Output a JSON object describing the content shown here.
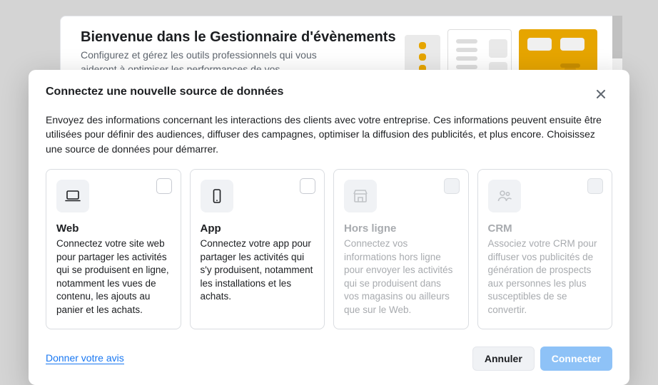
{
  "background": {
    "welcome_title": "Bienvenue dans le Gestionnaire d'évènements",
    "welcome_body": "Configurez et gérez les outils professionnels qui vous aideront à optimiser les performances de vos publicités."
  },
  "modal": {
    "title": "Connectez une nouvelle source de données",
    "description": "Envoyez des informations concernant les interactions des clients avec votre entreprise. Ces informations peuvent ensuite être utilisées pour définir des audiences, diffuser des campagnes, optimiser la diffusion des publicités, et plus encore. Choisissez une source de données pour démarrer.",
    "options": [
      {
        "icon": "laptop-icon",
        "title": "Web",
        "desc": "Connectez votre site web pour partager les activités qui se produisent en ligne, notamment les vues de contenu, les ajouts au panier et les achats.",
        "enabled": true
      },
      {
        "icon": "phone-icon",
        "title": "App",
        "desc": "Connectez votre app pour partager les activités qui s'y produisent, notamment les installations et les achats.",
        "enabled": true
      },
      {
        "icon": "storefront-icon",
        "title": "Hors ligne",
        "desc": "Connectez vos informations hors ligne pour envoyer les activités qui se produisent dans vos magasins ou ailleurs que sur le Web.",
        "enabled": false
      },
      {
        "icon": "people-icon",
        "title": "CRM",
        "desc": "Associez votre CRM pour diffuser vos publicités de génération de prospects aux personnes les plus susceptibles de se convertir.",
        "enabled": false
      }
    ],
    "feedback_label": "Donner votre avis",
    "cancel_label": "Annuler",
    "connect_label": "Connecter"
  }
}
